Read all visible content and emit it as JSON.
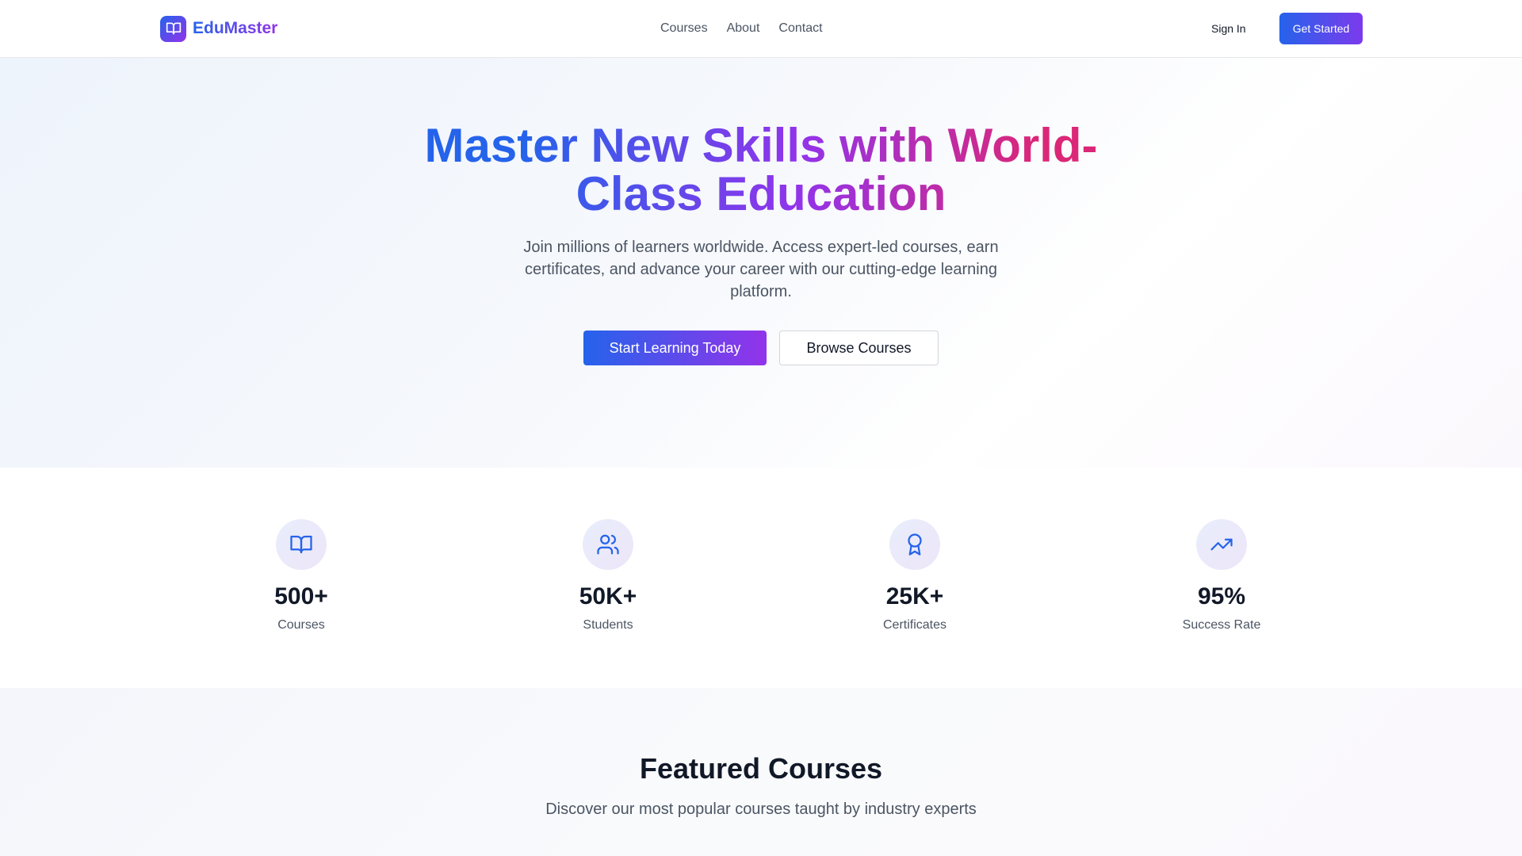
{
  "nav": {
    "brand": "EduMaster",
    "links": [
      "Courses",
      "About",
      "Contact"
    ],
    "sign_in": "Sign In",
    "get_started": "Get Started"
  },
  "hero": {
    "title": "Master New Skills with World-Class Education",
    "subtitle": "Join millions of learners worldwide. Access expert-led courses, earn certificates, and advance your career with our cutting-edge learning platform.",
    "primary_button": "Start Learning Today",
    "secondary_button": "Browse Courses"
  },
  "stats": [
    {
      "value": "500+",
      "label": "Courses",
      "icon": "book-open-icon"
    },
    {
      "value": "50K+",
      "label": "Students",
      "icon": "users-icon"
    },
    {
      "value": "25K+",
      "label": "Certificates",
      "icon": "award-icon"
    },
    {
      "value": "95%",
      "label": "Success Rate",
      "icon": "trending-up-icon"
    }
  ],
  "featured": {
    "title": "Featured Courses",
    "subtitle": "Discover our most popular courses taught by industry experts"
  },
  "colors": {
    "primary_blue": "#2563eb",
    "primary_purple": "#9333ea",
    "accent_pink": "#db2777",
    "text_dark": "#111827",
    "text_muted": "#4b5563"
  }
}
